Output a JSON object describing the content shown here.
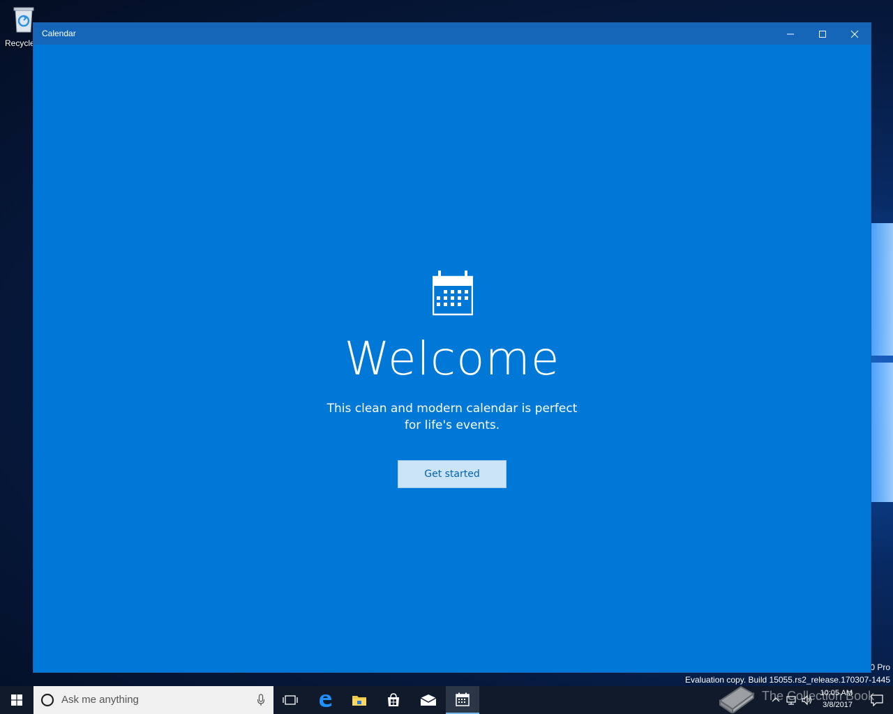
{
  "desktop": {
    "recycle_bin_label": "Recycle",
    "eval_edition": "0 Pro",
    "eval_build": "Evaluation copy. Build 15055.rs2_release.170307-1445"
  },
  "window": {
    "title": "Calendar",
    "accent_color": "#0078d7"
  },
  "welcome": {
    "title": "Welcome",
    "description": "This clean and modern calendar is perfect for life's events.",
    "button_label": "Get started"
  },
  "taskbar": {
    "search_placeholder": "Ask me anything",
    "pinned": [
      "task-view-icon",
      "edge-icon",
      "file-explorer-icon",
      "store-icon",
      "mail-icon",
      "calendar-icon"
    ],
    "clock_time": "10:05 AM",
    "clock_date": "3/8/2017"
  },
  "watermark": {
    "brand": "The Collection Book"
  }
}
